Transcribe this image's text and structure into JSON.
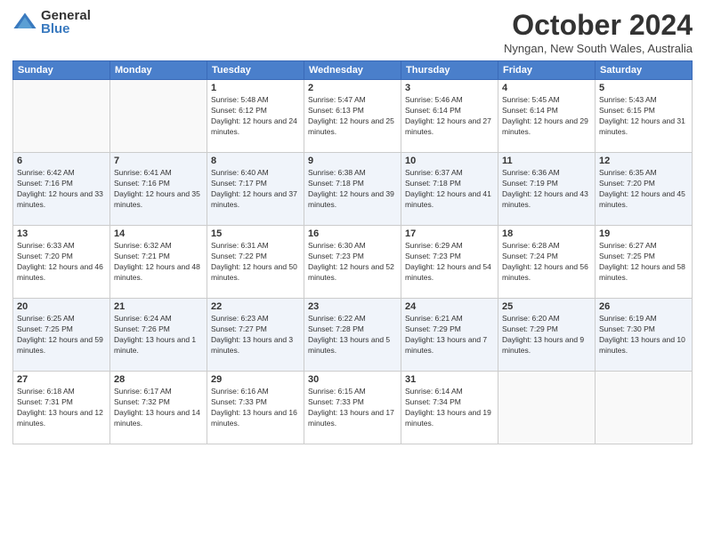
{
  "logo": {
    "general": "General",
    "blue": "Blue"
  },
  "header": {
    "month": "October 2024",
    "location": "Nyngan, New South Wales, Australia"
  },
  "weekdays": [
    "Sunday",
    "Monday",
    "Tuesday",
    "Wednesday",
    "Thursday",
    "Friday",
    "Saturday"
  ],
  "weeks": [
    [
      {
        "day": "",
        "info": ""
      },
      {
        "day": "",
        "info": ""
      },
      {
        "day": "1",
        "info": "Sunrise: 5:48 AM\nSunset: 6:12 PM\nDaylight: 12 hours and 24 minutes."
      },
      {
        "day": "2",
        "info": "Sunrise: 5:47 AM\nSunset: 6:13 PM\nDaylight: 12 hours and 25 minutes."
      },
      {
        "day": "3",
        "info": "Sunrise: 5:46 AM\nSunset: 6:14 PM\nDaylight: 12 hours and 27 minutes."
      },
      {
        "day": "4",
        "info": "Sunrise: 5:45 AM\nSunset: 6:14 PM\nDaylight: 12 hours and 29 minutes."
      },
      {
        "day": "5",
        "info": "Sunrise: 5:43 AM\nSunset: 6:15 PM\nDaylight: 12 hours and 31 minutes."
      }
    ],
    [
      {
        "day": "6",
        "info": "Sunrise: 6:42 AM\nSunset: 7:16 PM\nDaylight: 12 hours and 33 minutes."
      },
      {
        "day": "7",
        "info": "Sunrise: 6:41 AM\nSunset: 7:16 PM\nDaylight: 12 hours and 35 minutes."
      },
      {
        "day": "8",
        "info": "Sunrise: 6:40 AM\nSunset: 7:17 PM\nDaylight: 12 hours and 37 minutes."
      },
      {
        "day": "9",
        "info": "Sunrise: 6:38 AM\nSunset: 7:18 PM\nDaylight: 12 hours and 39 minutes."
      },
      {
        "day": "10",
        "info": "Sunrise: 6:37 AM\nSunset: 7:18 PM\nDaylight: 12 hours and 41 minutes."
      },
      {
        "day": "11",
        "info": "Sunrise: 6:36 AM\nSunset: 7:19 PM\nDaylight: 12 hours and 43 minutes."
      },
      {
        "day": "12",
        "info": "Sunrise: 6:35 AM\nSunset: 7:20 PM\nDaylight: 12 hours and 45 minutes."
      }
    ],
    [
      {
        "day": "13",
        "info": "Sunrise: 6:33 AM\nSunset: 7:20 PM\nDaylight: 12 hours and 46 minutes."
      },
      {
        "day": "14",
        "info": "Sunrise: 6:32 AM\nSunset: 7:21 PM\nDaylight: 12 hours and 48 minutes."
      },
      {
        "day": "15",
        "info": "Sunrise: 6:31 AM\nSunset: 7:22 PM\nDaylight: 12 hours and 50 minutes."
      },
      {
        "day": "16",
        "info": "Sunrise: 6:30 AM\nSunset: 7:23 PM\nDaylight: 12 hours and 52 minutes."
      },
      {
        "day": "17",
        "info": "Sunrise: 6:29 AM\nSunset: 7:23 PM\nDaylight: 12 hours and 54 minutes."
      },
      {
        "day": "18",
        "info": "Sunrise: 6:28 AM\nSunset: 7:24 PM\nDaylight: 12 hours and 56 minutes."
      },
      {
        "day": "19",
        "info": "Sunrise: 6:27 AM\nSunset: 7:25 PM\nDaylight: 12 hours and 58 minutes."
      }
    ],
    [
      {
        "day": "20",
        "info": "Sunrise: 6:25 AM\nSunset: 7:25 PM\nDaylight: 12 hours and 59 minutes."
      },
      {
        "day": "21",
        "info": "Sunrise: 6:24 AM\nSunset: 7:26 PM\nDaylight: 13 hours and 1 minute."
      },
      {
        "day": "22",
        "info": "Sunrise: 6:23 AM\nSunset: 7:27 PM\nDaylight: 13 hours and 3 minutes."
      },
      {
        "day": "23",
        "info": "Sunrise: 6:22 AM\nSunset: 7:28 PM\nDaylight: 13 hours and 5 minutes."
      },
      {
        "day": "24",
        "info": "Sunrise: 6:21 AM\nSunset: 7:29 PM\nDaylight: 13 hours and 7 minutes."
      },
      {
        "day": "25",
        "info": "Sunrise: 6:20 AM\nSunset: 7:29 PM\nDaylight: 13 hours and 9 minutes."
      },
      {
        "day": "26",
        "info": "Sunrise: 6:19 AM\nSunset: 7:30 PM\nDaylight: 13 hours and 10 minutes."
      }
    ],
    [
      {
        "day": "27",
        "info": "Sunrise: 6:18 AM\nSunset: 7:31 PM\nDaylight: 13 hours and 12 minutes."
      },
      {
        "day": "28",
        "info": "Sunrise: 6:17 AM\nSunset: 7:32 PM\nDaylight: 13 hours and 14 minutes."
      },
      {
        "day": "29",
        "info": "Sunrise: 6:16 AM\nSunset: 7:33 PM\nDaylight: 13 hours and 16 minutes."
      },
      {
        "day": "30",
        "info": "Sunrise: 6:15 AM\nSunset: 7:33 PM\nDaylight: 13 hours and 17 minutes."
      },
      {
        "day": "31",
        "info": "Sunrise: 6:14 AM\nSunset: 7:34 PM\nDaylight: 13 hours and 19 minutes."
      },
      {
        "day": "",
        "info": ""
      },
      {
        "day": "",
        "info": ""
      }
    ]
  ]
}
